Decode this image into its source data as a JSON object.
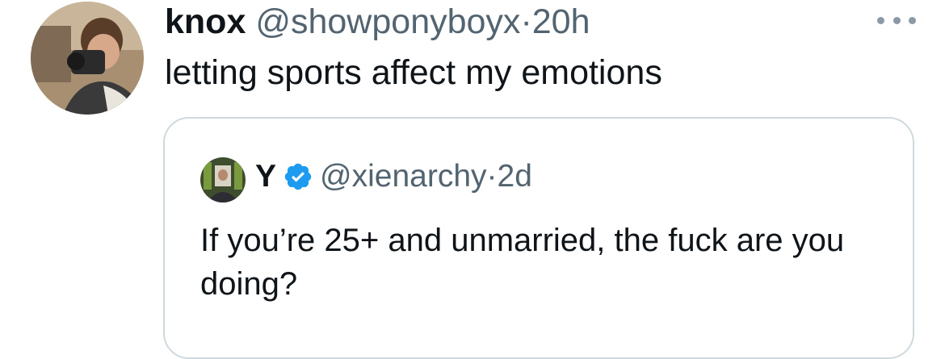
{
  "tweet": {
    "author_name": "knox",
    "author_handle": "@showponyboyx",
    "separator": "·",
    "time": "20h",
    "text": "letting sports affect my emotions",
    "avatar_icon": "profile-photo",
    "more_icon": "more-options-icon"
  },
  "quote": {
    "author_name": "Y",
    "author_handle": "@xienarchy",
    "separator": "·",
    "time": "2d",
    "text": "If you’re 25+ and unmarried, the fuck are you doing?",
    "verified_color": "#1d9bf0",
    "avatar_icon": "profile-photo"
  },
  "colors": {
    "text": "#0f1419",
    "secondary": "#536471",
    "border": "#cfd9de",
    "verified": "#1d9bf0"
  }
}
